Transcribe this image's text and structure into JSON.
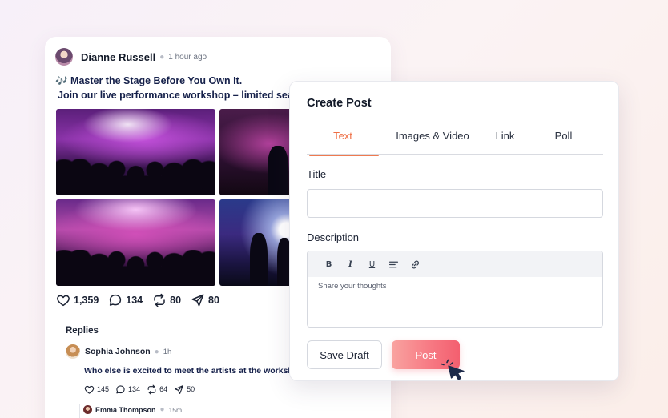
{
  "post": {
    "author": "Dianne Russell",
    "time": "1 hour ago",
    "text_line1": "🎶 Master the Stage Before You Own It.",
    "text_line2": "Join our live performance workshop – limited seats available!",
    "likes": "1,359",
    "comments": "134",
    "reposts": "80",
    "shares": "80"
  },
  "replies": {
    "title": "Replies",
    "items": [
      {
        "name": "Sophia Johnson",
        "time": "1h",
        "text": "Who else is excited to meet the artists at the workshop?",
        "likes": "145",
        "comments": "134",
        "reposts": "64",
        "shares": "50"
      },
      {
        "name": "Emma Thompson",
        "time": "15m"
      }
    ]
  },
  "modal": {
    "title": "Create Post",
    "tabs": [
      {
        "label": "Text",
        "active": true
      },
      {
        "label": "Images & Video",
        "active": false
      },
      {
        "label": "Link",
        "active": false
      },
      {
        "label": "Poll",
        "active": false
      }
    ],
    "title_label": "Title",
    "title_value": "",
    "description_label": "Description",
    "toolbar": {
      "bold": "B",
      "italic": "I",
      "underline": "U"
    },
    "description_placeholder": "Share your thoughts",
    "save_label": "Save Draft",
    "post_label": "Post"
  },
  "colors": {
    "accent": "#ef6f45",
    "post_button": "#f77a84",
    "text_dark": "#1b2233"
  },
  "icons": [
    "heart-icon",
    "comment-icon",
    "repost-icon",
    "send-icon",
    "align-left-icon",
    "link-icon",
    "pointer-cursor-icon"
  ]
}
